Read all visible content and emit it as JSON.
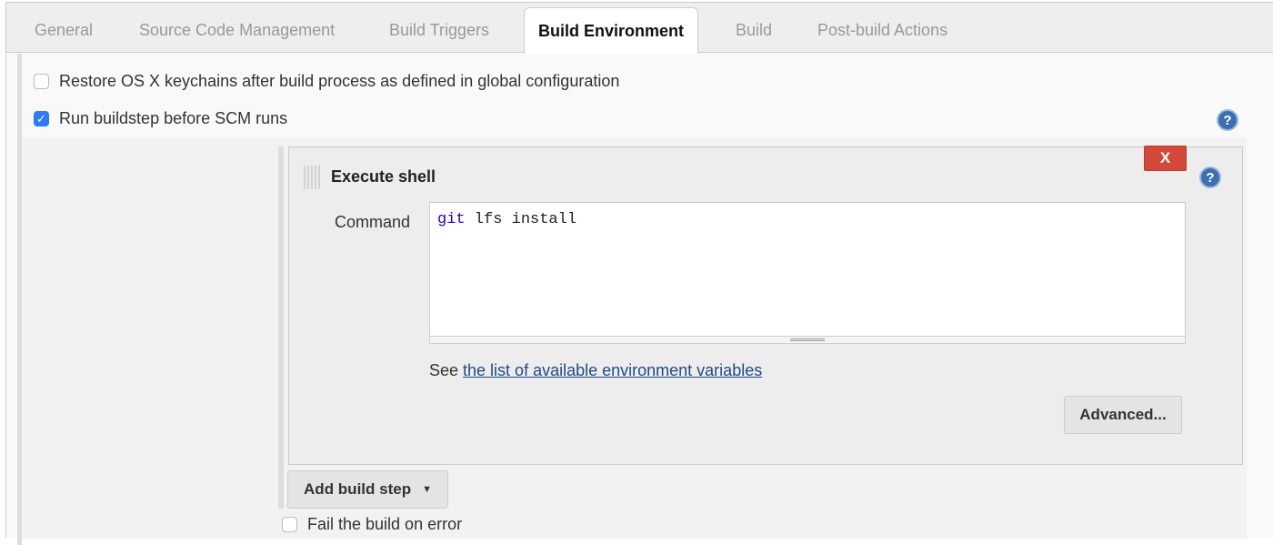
{
  "tabs": [
    {
      "label": "General"
    },
    {
      "label": "Source Code Management"
    },
    {
      "label": "Build Triggers"
    },
    {
      "label": "Build Environment",
      "active": true
    },
    {
      "label": "Build"
    },
    {
      "label": "Post-build Actions"
    }
  ],
  "options": {
    "restore_keychains": {
      "label": "Restore OS X keychains after build process as defined in global configuration",
      "checked": false
    },
    "run_buildstep": {
      "label": "Run buildstep before SCM runs",
      "checked": true
    }
  },
  "step": {
    "title": "Execute shell",
    "delete_label": "X",
    "command_label": "Command",
    "command_keyword": "git",
    "command_rest": " lfs install",
    "see_text": "See ",
    "env_link": "the list of available environment variables",
    "advanced_label": "Advanced..."
  },
  "add_build_step_label": "Add build step",
  "fail_on_error": {
    "label": "Fail the build on error",
    "checked": false
  },
  "colors": {
    "accent": "#2d7cf6",
    "delete": "#d24939",
    "link": "#204a87",
    "keyword": "#2200cc"
  }
}
